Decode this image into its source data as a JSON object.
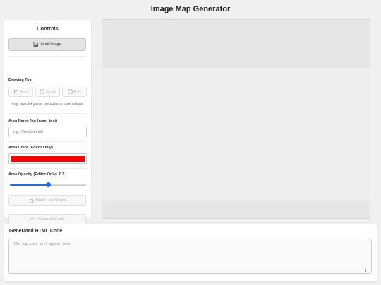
{
  "app": {
    "title": "Image Map Generator"
  },
  "controls": {
    "title": "Controls",
    "load_label": "Load Image",
    "drawing_tool_label": "Drawing Tool",
    "tools": [
      {
        "label": "Rect",
        "icon": "rect-icon"
      },
      {
        "label": "Circle",
        "icon": "circle-icon"
      },
      {
        "label": "Poly",
        "icon": "polygon-icon"
      }
    ],
    "poly_hint": "Poly: Tap/Click points. Use button or Enter to finish.",
    "area_name_label": "Area Name (for hover text)",
    "area_name_placeholder": "e.g., Product Link",
    "area_name_value": "",
    "area_color_label": "Area Color (Editor Only)",
    "area_color": "#ff0000",
    "area_opacity_label": "Area Opacity (Editor Only)",
    "area_opacity_value": "0.5",
    "area_opacity": 0.5,
    "undo_label": "Undo Last Shape",
    "generate_label": "Generate Code"
  },
  "output": {
    "title": "Generated HTML Code",
    "placeholder": "HTML map code will appear here...",
    "value": ""
  },
  "colors": {
    "accent": "#1a73e8",
    "background": "#f0f0f0",
    "panel": "#ffffff"
  }
}
